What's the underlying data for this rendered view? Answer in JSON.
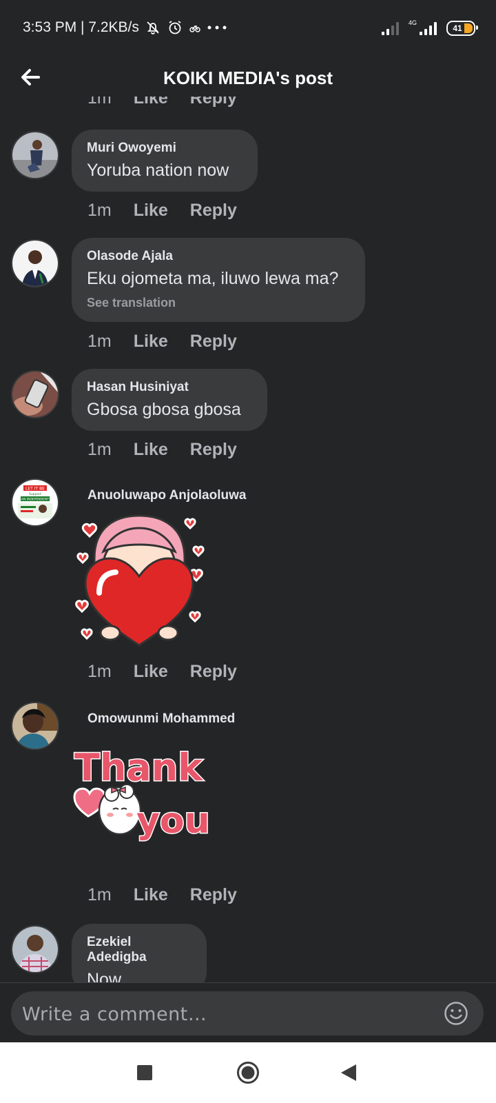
{
  "status_bar": {
    "time_speed": "3:53 PM | 7.2KB/s",
    "network": "4G",
    "battery": "41"
  },
  "header": {
    "title": "KOIKI MEDIA's post"
  },
  "partial_top_actions": {
    "time": "1m",
    "like": "Like",
    "reply": "Reply"
  },
  "comments": [
    {
      "name": "Muri Owoyemi",
      "text": "Yoruba nation now",
      "time": "1m",
      "like": "Like",
      "reply": "Reply"
    },
    {
      "name": "Olasode Ajala",
      "text": "Eku ojometa ma, iluwo lewa ma?",
      "see_translation": "See translation",
      "time": "1m",
      "like": "Like",
      "reply": "Reply"
    },
    {
      "name": "Hasan Husiniyat",
      "text": "Gbosa gbosa gbosa",
      "time": "1m",
      "like": "Like",
      "reply": "Reply"
    },
    {
      "name": "Anuoluwapo Anjolaoluwa",
      "sticker": "heart-girl-sticker",
      "time": "1m",
      "like": "Like",
      "reply": "Reply"
    },
    {
      "name": "Omowunmi Mohammed",
      "sticker": "thank-you-sticker",
      "sticker_text_1": "Thank",
      "sticker_text_2": "you",
      "time": "1m",
      "like": "Like",
      "reply": "Reply"
    },
    {
      "name": "Ezekiel Adedigba",
      "text": "Now"
    }
  ],
  "avatar_5_text": {
    "line1": "LET IT BE",
    "line2": "Support",
    "line3": "AN INDEPENDENT"
  },
  "composer": {
    "placeholder": "Write a comment…"
  },
  "colors": {
    "background": "#242526",
    "bubble": "#3a3b3c",
    "accent_sticker": "#e8566a"
  },
  "icons": [
    "back-arrow-icon",
    "smiley-icon",
    "square-nav-icon",
    "circle-nav-icon",
    "triangle-back-icon"
  ]
}
